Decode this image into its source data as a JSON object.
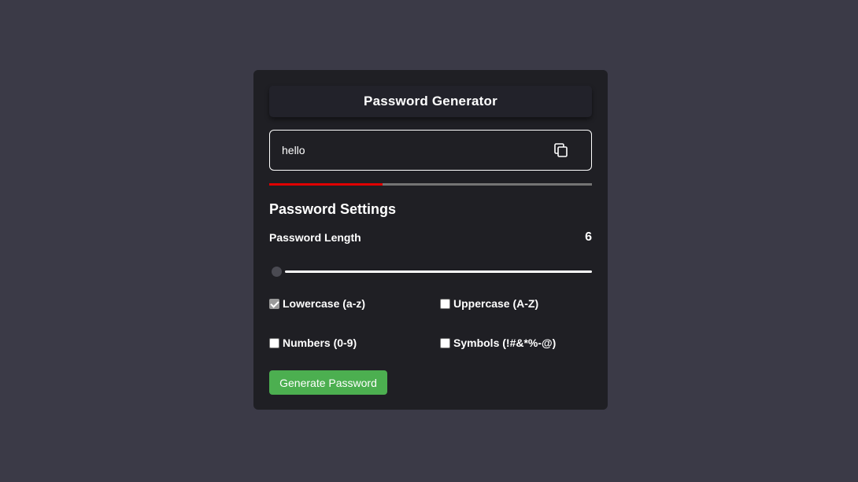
{
  "app": {
    "title": "Password Generator"
  },
  "password": {
    "value": "hello",
    "copy_icon": "copy-icon"
  },
  "strength": {
    "level": 0.35,
    "color": "#e00000"
  },
  "settings": {
    "heading": "Password Settings",
    "length_label": "Password Length",
    "length_value": "6",
    "options": [
      {
        "label": "Lowercase (a-z)",
        "checked": true
      },
      {
        "label": "Uppercase (A-Z)",
        "checked": false
      },
      {
        "label": "Numbers (0-9)",
        "checked": false
      },
      {
        "label": "Symbols (!#&*%-@)",
        "checked": false
      }
    ]
  },
  "actions": {
    "generate_label": "Generate Password",
    "generate_color": "#4caf50"
  }
}
